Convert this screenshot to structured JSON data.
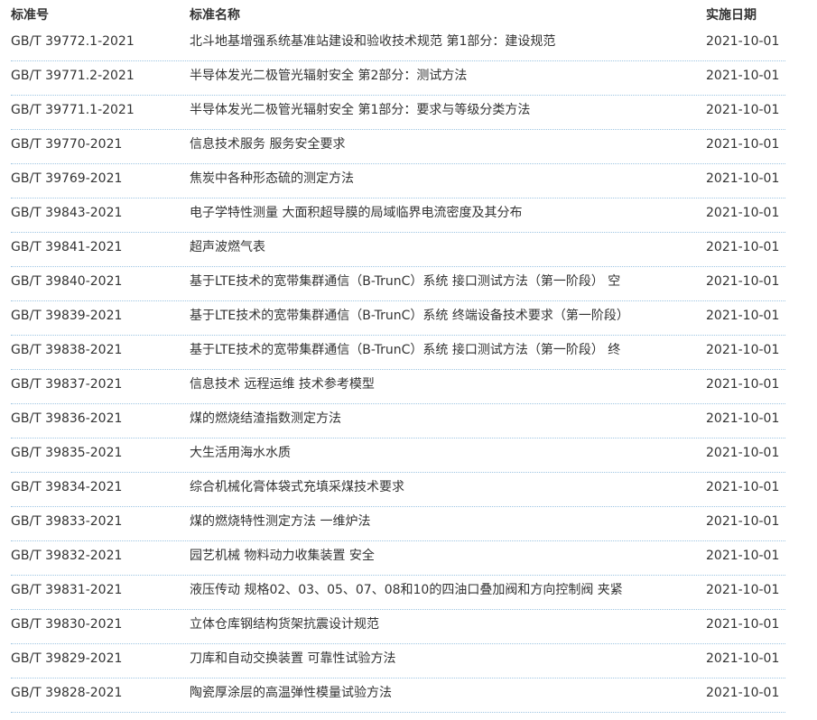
{
  "table": {
    "headers": {
      "code": "标准号",
      "name": "标准名称",
      "date": "实施日期"
    },
    "rows": [
      {
        "code": "GB/T 39772.1-2021",
        "name": "北斗地基增强系统基准站建设和验收技术规范 第1部分：建设规范",
        "date": "2021-10-01"
      },
      {
        "code": "GB/T 39771.2-2021",
        "name": "半导体发光二极管光辐射安全 第2部分：测试方法",
        "date": "2021-10-01"
      },
      {
        "code": "GB/T 39771.1-2021",
        "name": "半导体发光二极管光辐射安全 第1部分：要求与等级分类方法",
        "date": "2021-10-01"
      },
      {
        "code": "GB/T 39770-2021",
        "name": "信息技术服务 服务安全要求",
        "date": "2021-10-01"
      },
      {
        "code": "GB/T 39769-2021",
        "name": "焦炭中各种形态硫的测定方法",
        "date": "2021-10-01"
      },
      {
        "code": "GB/T 39843-2021",
        "name": "电子学特性测量 大面积超导膜的局域临界电流密度及其分布",
        "date": "2021-10-01"
      },
      {
        "code": "GB/T 39841-2021",
        "name": "超声波燃气表",
        "date": "2021-10-01"
      },
      {
        "code": "GB/T 39840-2021",
        "name": "基于LTE技术的宽带集群通信（B-TrunC）系统 接口测试方法（第一阶段） 空",
        "date": "2021-10-01"
      },
      {
        "code": "GB/T 39839-2021",
        "name": "基于LTE技术的宽带集群通信（B-TrunC）系统 终端设备技术要求（第一阶段）",
        "date": "2021-10-01"
      },
      {
        "code": "GB/T 39838-2021",
        "name": "基于LTE技术的宽带集群通信（B-TrunC）系统 接口测试方法（第一阶段） 终",
        "date": "2021-10-01"
      },
      {
        "code": "GB/T 39837-2021",
        "name": "信息技术 远程运维 技术参考模型",
        "date": "2021-10-01"
      },
      {
        "code": "GB/T 39836-2021",
        "name": "煤的燃烧结渣指数测定方法",
        "date": "2021-10-01"
      },
      {
        "code": "GB/T 39835-2021",
        "name": "大生活用海水水质",
        "date": "2021-10-01"
      },
      {
        "code": "GB/T 39834-2021",
        "name": "综合机械化膏体袋式充填采煤技术要求",
        "date": "2021-10-01"
      },
      {
        "code": "GB/T 39833-2021",
        "name": "煤的燃烧特性测定方法 一维炉法",
        "date": "2021-10-01"
      },
      {
        "code": "GB/T 39832-2021",
        "name": "园艺机械 物料动力收集装置 安全",
        "date": "2021-10-01"
      },
      {
        "code": "GB/T 39831-2021",
        "name": "液压传动 规格02、03、05、07、08和10的四油口叠加阀和方向控制阀 夹紧",
        "date": "2021-10-01"
      },
      {
        "code": "GB/T 39830-2021",
        "name": "立体仓库钢结构货架抗震设计规范",
        "date": "2021-10-01"
      },
      {
        "code": "GB/T 39829-2021",
        "name": "刀库和自动交换装置 可靠性试验方法",
        "date": "2021-10-01"
      },
      {
        "code": "GB/T 39828-2021",
        "name": "陶瓷厚涂层的高温弹性模量试验方法",
        "date": "2021-10-01"
      }
    ]
  }
}
